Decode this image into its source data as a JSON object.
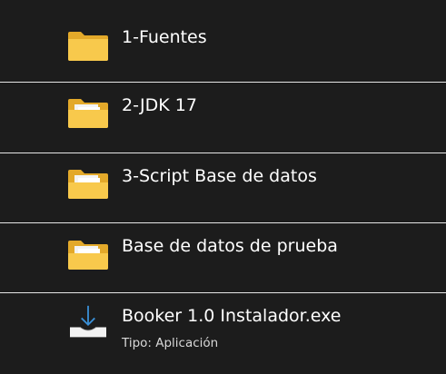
{
  "items": [
    {
      "name": "1-Fuentes",
      "icon": "folder-icon"
    },
    {
      "name": "2-JDK 17",
      "icon": "folder-with-documents-icon"
    },
    {
      "name": "3-Script Base de datos",
      "icon": "folder-with-documents-icon"
    },
    {
      "name": "Base de datos de prueba",
      "icon": "folder-with-documents-icon"
    },
    {
      "name": "Booker 1.0 Instalador.exe",
      "type_label": "Tipo: Aplicación",
      "icon": "installer-icon"
    }
  ],
  "colors": {
    "background": "#1c1c1c",
    "divider": "#e6e6e6",
    "folder_front": "#f8c94c",
    "folder_back": "#e3a92a",
    "accent_blue": "#3a8fd6"
  }
}
